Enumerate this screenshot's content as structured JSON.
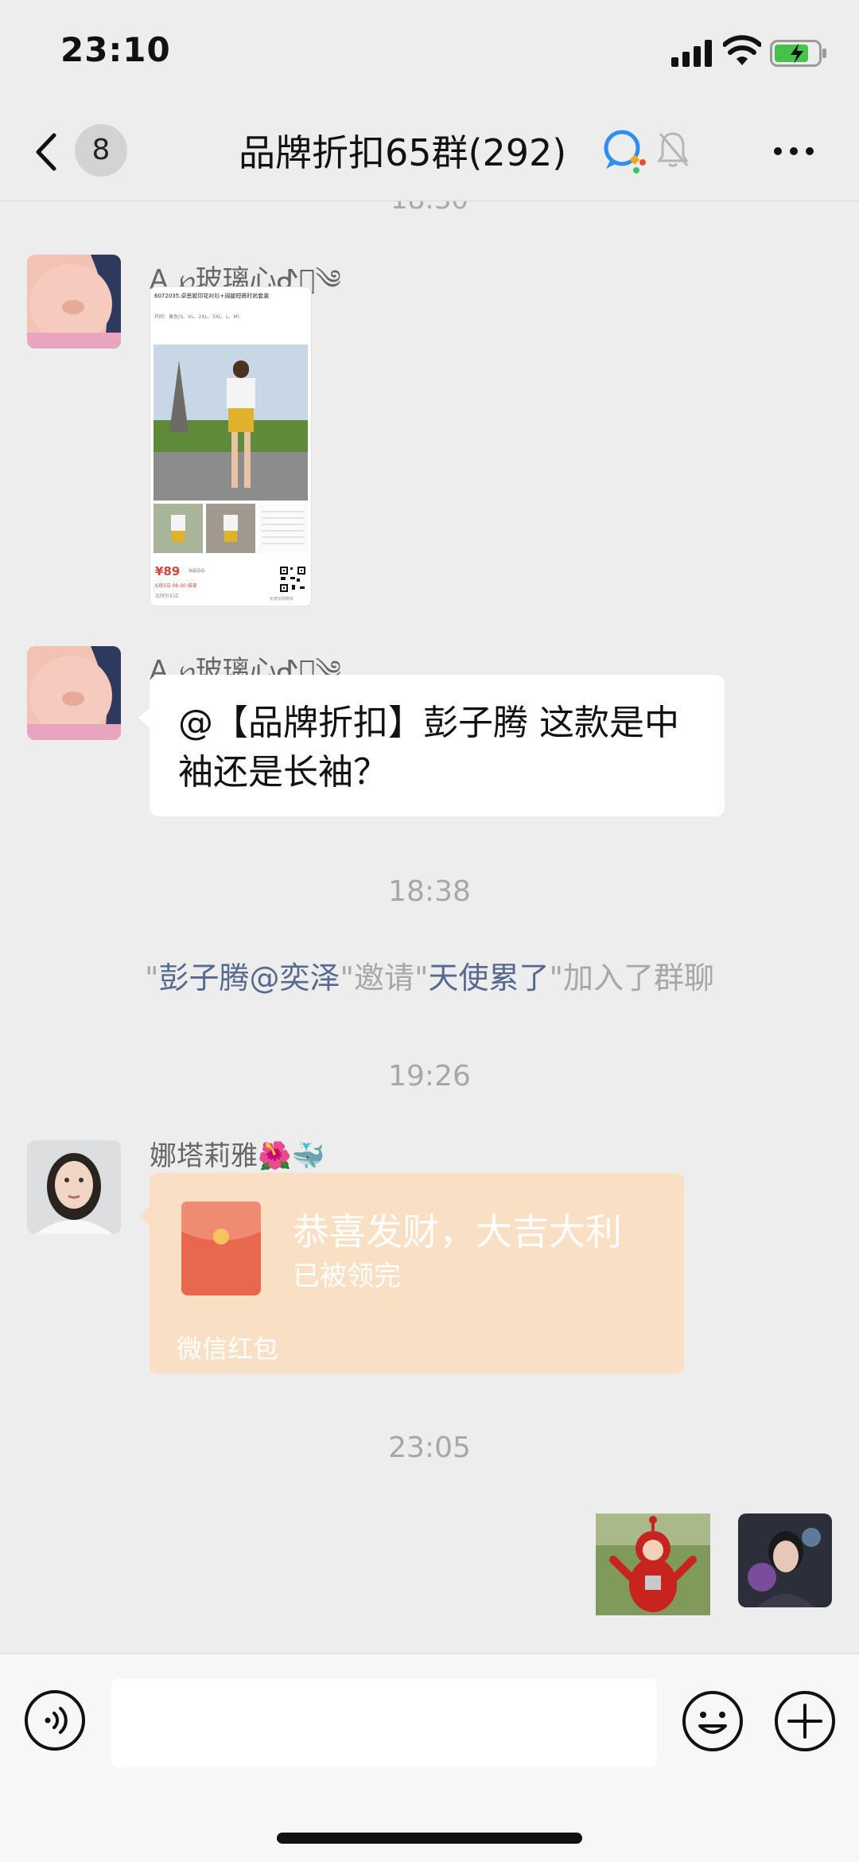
{
  "status_bar": {
    "time": "23:10"
  },
  "nav": {
    "back_count": "8",
    "title": "品牌折扣65群(292)"
  },
  "messages": {
    "partial_time": "18:30",
    "msg1": {
      "sender": "A   ℘玻璃心ᕷ͛༄",
      "card": {
        "code_title": "6072035.卓思妮印花衬衫+阔腿短裤时尚套装",
        "sizes": "尺码：黄色(S、XL、2XL、3XL、L、M)",
        "price": "¥89",
        "old_price": "¥899",
        "promo": "6月5日 08:00 结束",
        "shop": "品牌折扣店",
        "scan_text": "长按识别购买"
      }
    },
    "msg2": {
      "sender": "A   ℘玻璃心ᕷ͛༄",
      "text": "@【品牌折扣】彭子腾 这款是中袖还是长袖？"
    },
    "time1": "18:38",
    "system": {
      "quote1": "\"",
      "inviter": "彭子腾@奕泽",
      "quote_mid": "\"邀请\"",
      "invitee": "天使累了",
      "tail": "\"加入了群聊"
    },
    "time2": "19:26",
    "msg3": {
      "sender": "娜塔莉雅🌺🐳",
      "redpacket": {
        "greeting": "恭喜发财，大吉大利",
        "status": "已被领完",
        "brand": "微信红包"
      }
    },
    "time3": "23:05"
  },
  "colors": {
    "background": "#ededed",
    "link": "#56698f",
    "redpacket": "#f9e0c5",
    "redpacket_icon": "#e8674f"
  }
}
